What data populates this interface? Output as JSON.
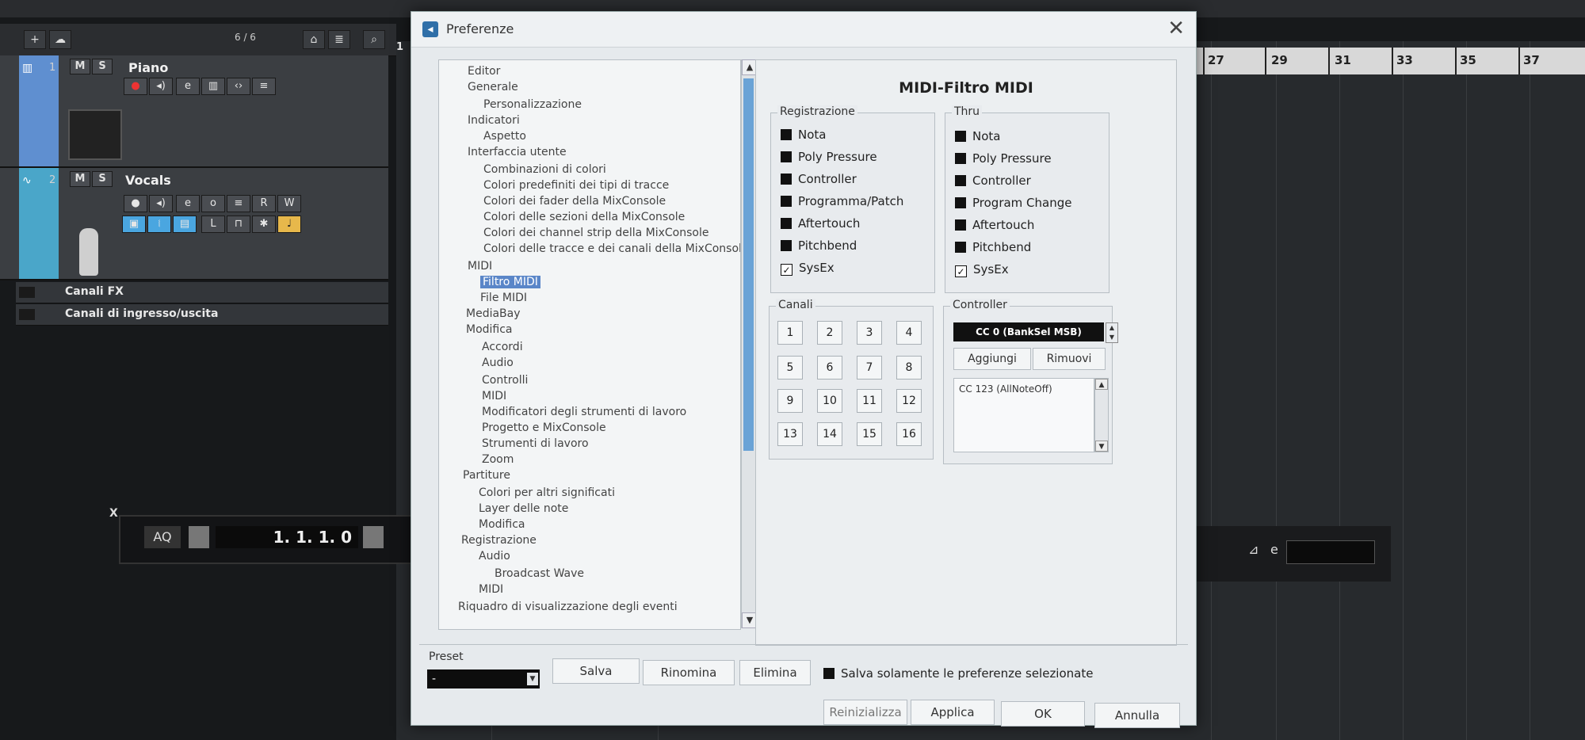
{
  "daw": {
    "track_counter": "6 / 6",
    "ruler_bars": [
      "27",
      "29",
      "31",
      "33",
      "35",
      "37"
    ],
    "tracks": [
      {
        "number": "1",
        "mute": "M",
        "solo": "S",
        "name": "Piano"
      },
      {
        "number": "2",
        "mute": "M",
        "solo": "S",
        "name": "Vocals"
      }
    ],
    "track2_buttons": {
      "r": "R",
      "w": "W",
      "l": "L"
    },
    "folders": [
      "Canali FX",
      "Canali di ingresso/uscita"
    ],
    "transport": {
      "aq": "AQ",
      "position": "1. 1. 1.   0",
      "close": "X"
    },
    "timeline_marker": "1"
  },
  "dialog": {
    "title": "Preferenze",
    "close": "✕",
    "tree": [
      "Editor",
      "Generale",
      "Personalizzazione",
      "Indicatori",
      "Aspetto",
      "Interfaccia utente",
      "Combinazioni di colori",
      "Colori predefiniti dei tipi di tracce",
      "Colori dei fader della MixConsole",
      "Colori delle sezioni della MixConsole",
      "Colori dei channel strip della MixConsole",
      "Colori delle tracce e dei canali della MixConsole",
      "MIDI",
      "Filtro MIDI",
      "File MIDI",
      "MediaBay",
      "Modifica",
      "Accordi",
      "Audio",
      "Controlli",
      "MIDI",
      "Modificatori degli strumenti di lavoro",
      "Progetto e MixConsole",
      "Strumenti di lavoro",
      "Zoom",
      "Partiture",
      "Colori per altri significati",
      "Layer delle note",
      "Modifica",
      "Registrazione",
      "Audio",
      "Broadcast Wave",
      "MIDI",
      "Riquadro di visualizzazione degli eventi"
    ],
    "pane_title": "MIDI-Filtro MIDI",
    "registrazione": {
      "label": "Registrazione",
      "items": [
        {
          "label": "Nota",
          "checked": false
        },
        {
          "label": "Poly Pressure",
          "checked": false
        },
        {
          "label": "Controller",
          "checked": false
        },
        {
          "label": "Programma/Patch",
          "checked": false
        },
        {
          "label": "Aftertouch",
          "checked": false
        },
        {
          "label": "Pitchbend",
          "checked": false
        },
        {
          "label": "SysEx",
          "checked": true
        }
      ]
    },
    "thru": {
      "label": "Thru",
      "items": [
        {
          "label": "Nota",
          "checked": false
        },
        {
          "label": "Poly Pressure",
          "checked": false
        },
        {
          "label": "Controller",
          "checked": false
        },
        {
          "label": "Program Change",
          "checked": false
        },
        {
          "label": "Aftertouch",
          "checked": false
        },
        {
          "label": "Pitchbend",
          "checked": false
        },
        {
          "label": "SysEx",
          "checked": true
        }
      ]
    },
    "canali": {
      "label": "Canali",
      "channels": [
        "1",
        "2",
        "3",
        "4",
        "5",
        "6",
        "7",
        "8",
        "9",
        "10",
        "11",
        "12",
        "13",
        "14",
        "15",
        "16"
      ]
    },
    "controller": {
      "label": "Controller",
      "selected": "CC 0  (BankSel MSB)",
      "add": "Aggiungi",
      "remove": "Rimuovi",
      "list": [
        "CC 123  (AllNoteOff)"
      ]
    },
    "preset": {
      "label": "Preset",
      "value": "-",
      "save": "Salva",
      "rename": "Rinomina",
      "delete": "Elimina",
      "save_selected": "Salva solamente le preferenze selezionate"
    },
    "footer": {
      "reset": "Reinizializza",
      "apply": "Applica",
      "ok": "OK",
      "cancel": "Annulla"
    }
  }
}
